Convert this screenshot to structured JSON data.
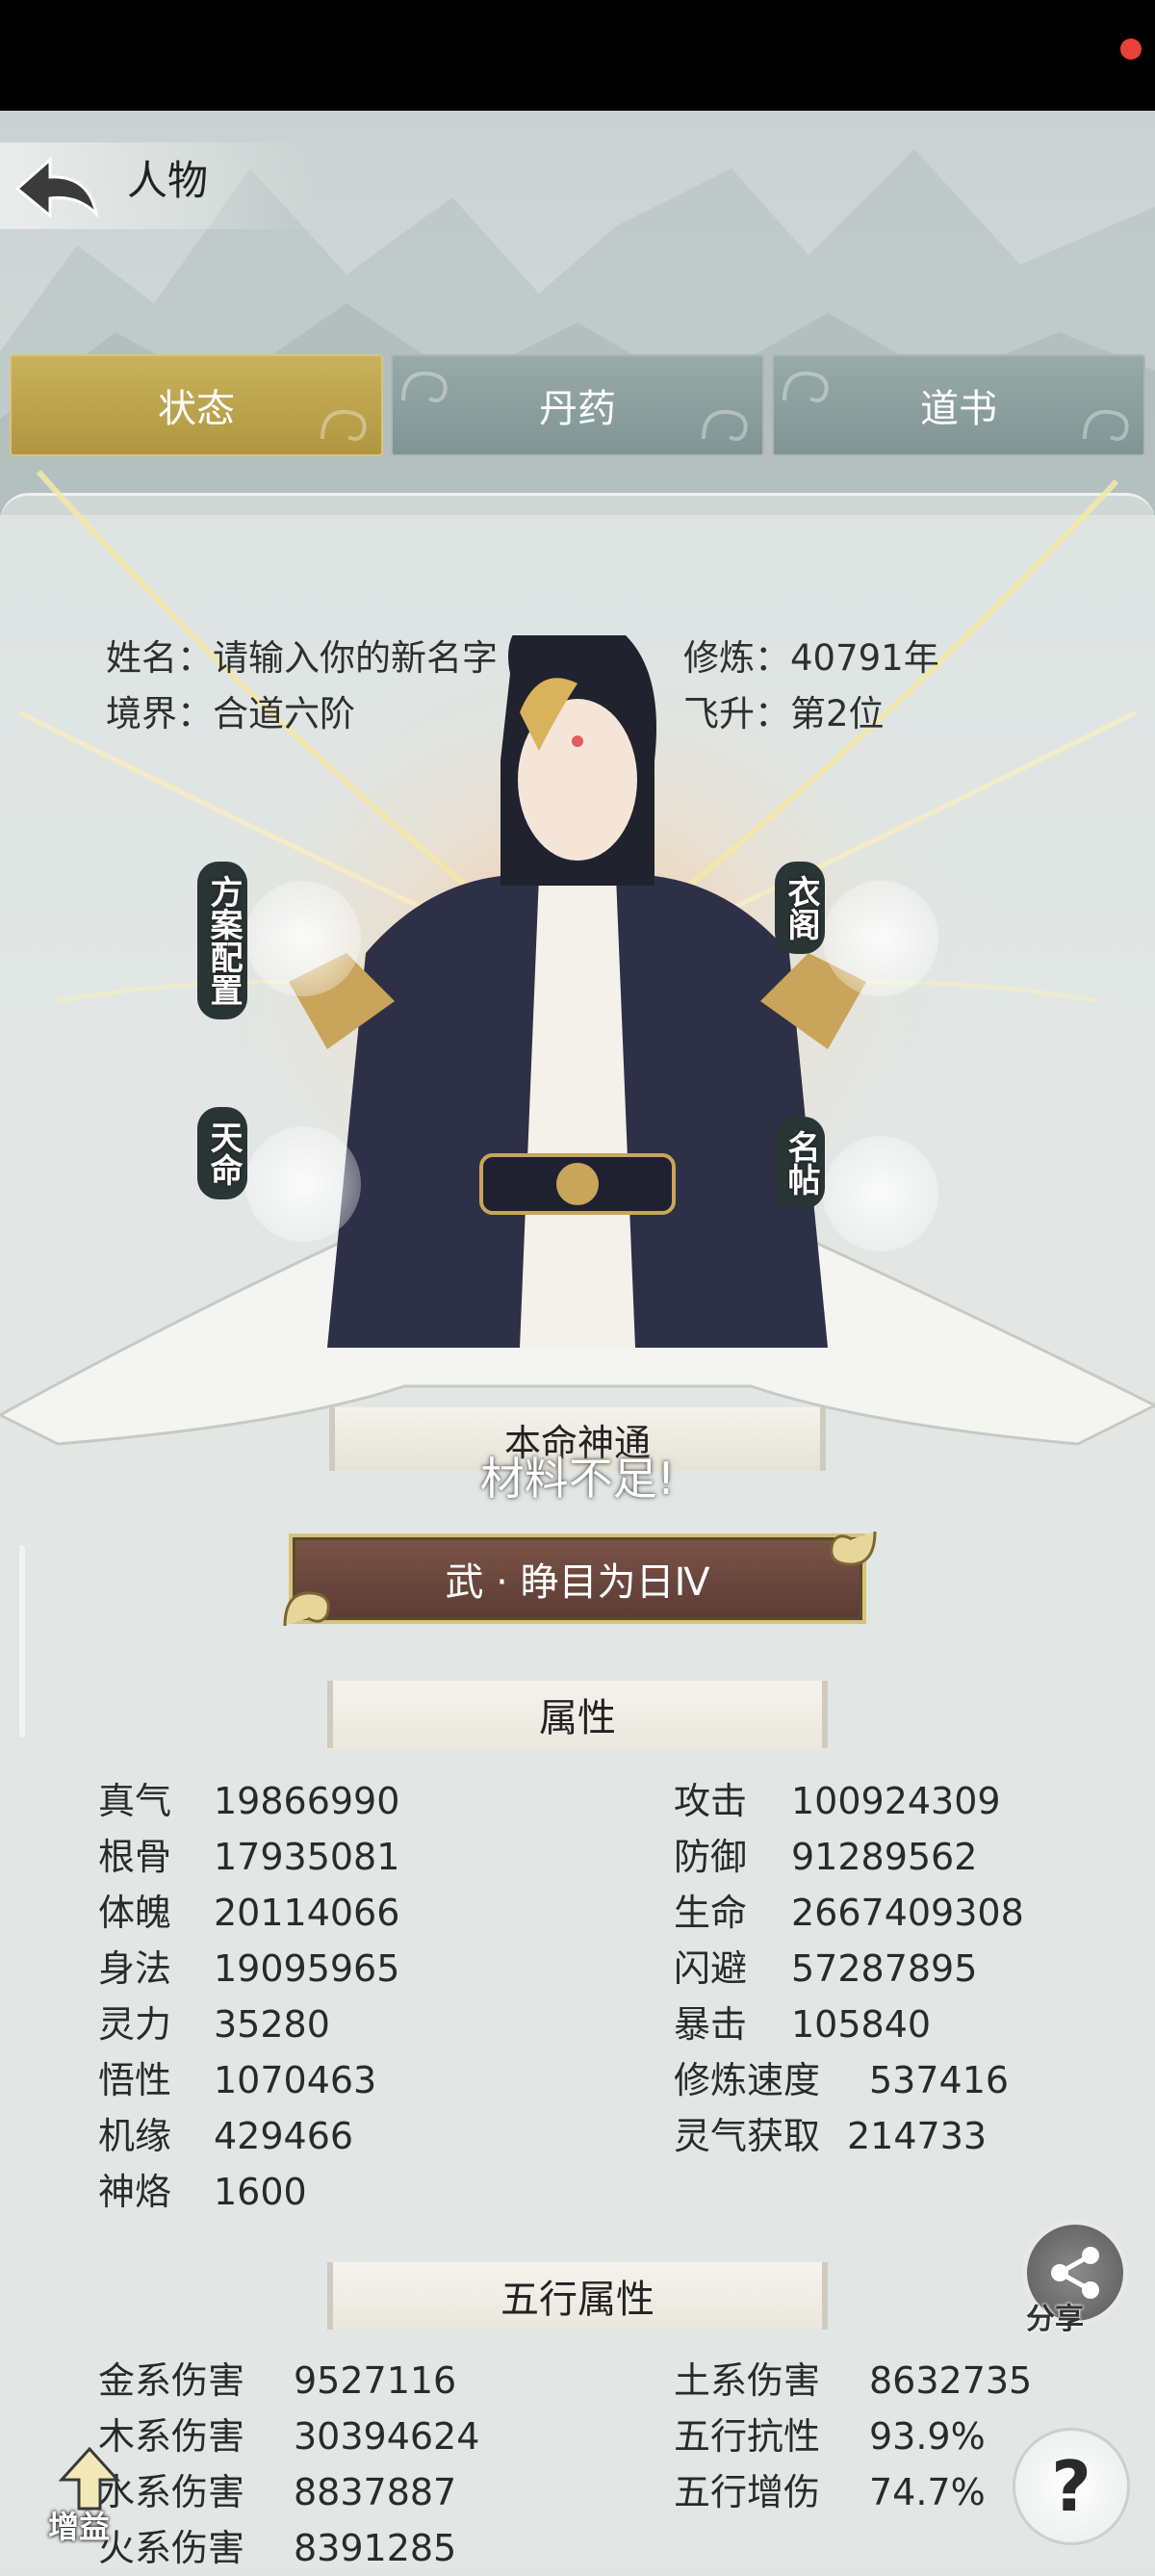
{
  "header": {
    "title": "人物"
  },
  "tabs": [
    {
      "label": "状态",
      "active": true
    },
    {
      "label": "丹药",
      "active": false
    },
    {
      "label": "道书",
      "active": false
    }
  ],
  "profile": {
    "name": "姓名：请输入你的新名字",
    "realm": "境界：合道六阶",
    "cultivation": "修炼：40791年",
    "ascension": "飞升：第2位"
  },
  "side_buttons": {
    "plan_config": "方案配置",
    "fate": "天命",
    "wardrobe": "衣阁",
    "name_card": "名帖"
  },
  "skill": {
    "section_title": "本命神通",
    "warning": "材料不足!",
    "button_label": "武 · 睁目为日Ⅳ"
  },
  "attributes": {
    "title": "属性",
    "left": [
      {
        "name": "真气",
        "value": "19866990"
      },
      {
        "name": "根骨",
        "value": "17935081"
      },
      {
        "name": "体魄",
        "value": "20114066"
      },
      {
        "name": "身法",
        "value": "19095965"
      },
      {
        "name": "灵力",
        "value": "35280"
      },
      {
        "name": "悟性",
        "value": "1070463"
      },
      {
        "name": "机缘",
        "value": "429466"
      },
      {
        "name": "神烙",
        "value": "1600"
      }
    ],
    "right": [
      {
        "name": "攻击",
        "value": "100924309"
      },
      {
        "name": "防御",
        "value": "91289562"
      },
      {
        "name": "生命",
        "value": "2667409308"
      },
      {
        "name": "闪避",
        "value": "57287895"
      },
      {
        "name": "暴击",
        "value": "105840"
      },
      {
        "name": "修炼速度",
        "value": "537416"
      },
      {
        "name": "灵气获取",
        "value": "214733"
      }
    ]
  },
  "elements": {
    "title": "五行属性",
    "left": [
      {
        "name": "金系伤害",
        "value": "9527116"
      },
      {
        "name": "木系伤害",
        "value": "30394624"
      },
      {
        "name": "水系伤害",
        "value": "8837887"
      },
      {
        "name": "火系伤害",
        "value": "8391285"
      }
    ],
    "right": [
      {
        "name": "土系伤害",
        "value": "8632735"
      },
      {
        "name": "五行抗性",
        "value": "93.9%"
      },
      {
        "name": "五行增伤",
        "value": "74.7%"
      }
    ]
  },
  "floating": {
    "share_label": "分享",
    "help_label": "?",
    "boost_label": "增益"
  },
  "colors": {
    "active_tab": "#c0a64e",
    "inactive_tab": "#889d9c",
    "skill_button": "#6a4840"
  }
}
